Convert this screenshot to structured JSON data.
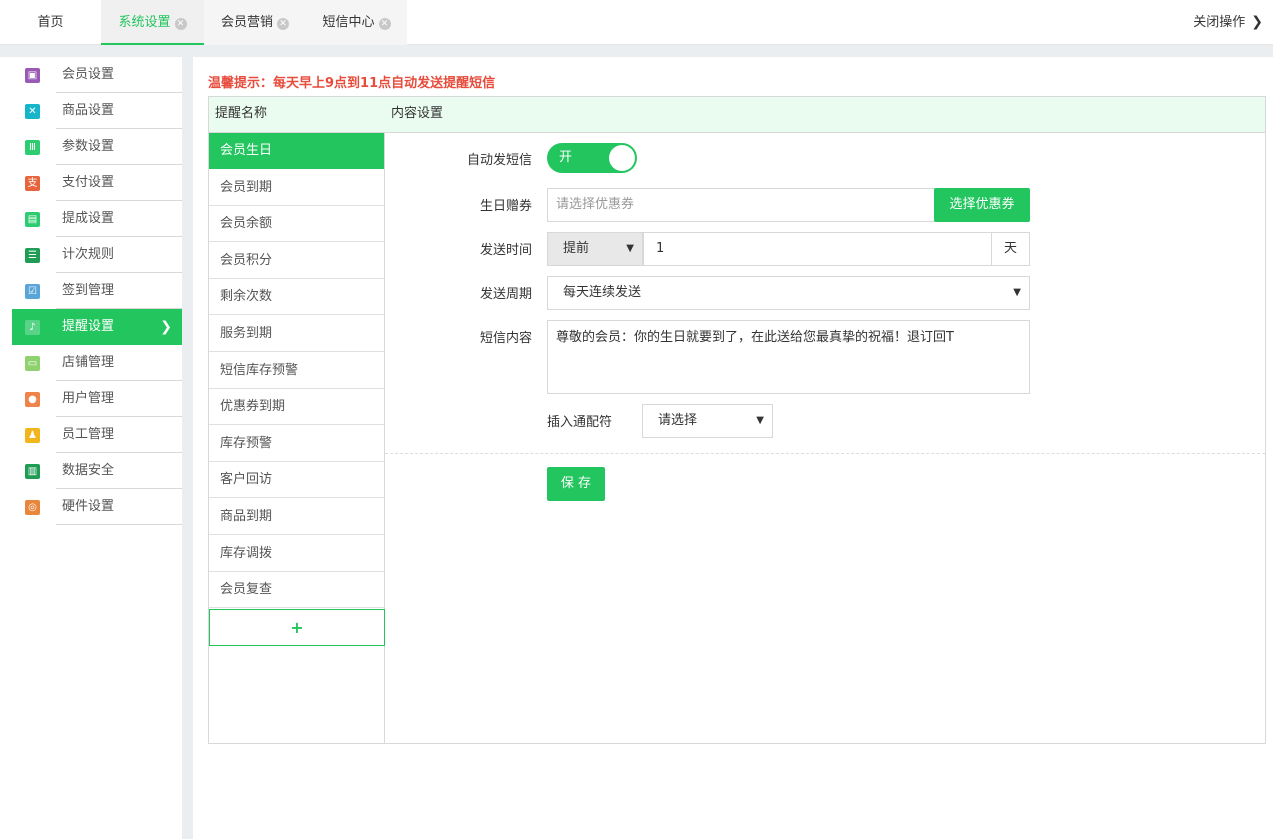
{
  "topbar": {
    "home": "首页",
    "tabs": [
      {
        "label": "系统设置",
        "active": true
      },
      {
        "label": "会员营销",
        "active": false
      },
      {
        "label": "短信中心",
        "active": false
      }
    ],
    "close_ops": "关闭操作"
  },
  "sidebar": {
    "items": [
      {
        "label": "会员设置",
        "icon": "member-settings-icon",
        "color": "#9b59b6"
      },
      {
        "label": "商品设置",
        "icon": "tools-icon",
        "color": "#17b5c9"
      },
      {
        "label": "参数设置",
        "icon": "sliders-icon",
        "color": "#2ecc71"
      },
      {
        "label": "支付设置",
        "icon": "payment-icon",
        "color": "#e8643c"
      },
      {
        "label": "提成设置",
        "icon": "commission-icon",
        "color": "#2ecc71"
      },
      {
        "label": "计次规则",
        "icon": "rules-icon",
        "color": "#1f9d55"
      },
      {
        "label": "签到管理",
        "icon": "calendar-check-icon",
        "color": "#5aa5d8"
      },
      {
        "label": "提醒设置",
        "icon": "bell-icon",
        "color": "#22c55e",
        "active": true
      },
      {
        "label": "店铺管理",
        "icon": "store-icon",
        "color": "#8ed16e"
      },
      {
        "label": "用户管理",
        "icon": "user-icon",
        "color": "#f0834a"
      },
      {
        "label": "员工管理",
        "icon": "staff-icon",
        "color": "#f2b51c"
      },
      {
        "label": "数据安全",
        "icon": "chart-icon",
        "color": "#1f9d55"
      },
      {
        "label": "硬件设置",
        "icon": "hardware-icon",
        "color": "#e8863c"
      }
    ]
  },
  "main": {
    "tip": "温馨提示：每天早上9点到11点自动发送提醒短信",
    "table": {
      "col1": "提醒名称",
      "col2": "内容设置"
    },
    "reminders": [
      "会员生日",
      "会员到期",
      "会员余额",
      "会员积分",
      "剩余次数",
      "服务到期",
      "短信库存预警",
      "优惠券到期",
      "库存预警",
      "客户回访",
      "商品到期",
      "库存调拨",
      "会员复查"
    ],
    "add_label": "+",
    "form": {
      "auto_sms_label": "自动发短信",
      "toggle_text": "开",
      "gift_label": "生日赠券",
      "gift_placeholder": "请选择优惠券",
      "gift_button": "选择优惠券",
      "send_time_label": "发送时间",
      "send_time_mode": "提前",
      "send_time_value": "1",
      "send_time_unit": "天",
      "cycle_label": "发送周期",
      "cycle_value": "每天连续发送",
      "content_label": "短信内容",
      "content_value": "尊敬的会员：你的生日就要到了，在此送给您最真挚的祝福！退订回T",
      "placeholder_label": "插入通配符",
      "placeholder_select": "请选择",
      "save_button": "保 存"
    }
  },
  "colors": {
    "accent": "#22c55e",
    "tip": "#e74c3c",
    "header_bg": "#eafcf0"
  }
}
